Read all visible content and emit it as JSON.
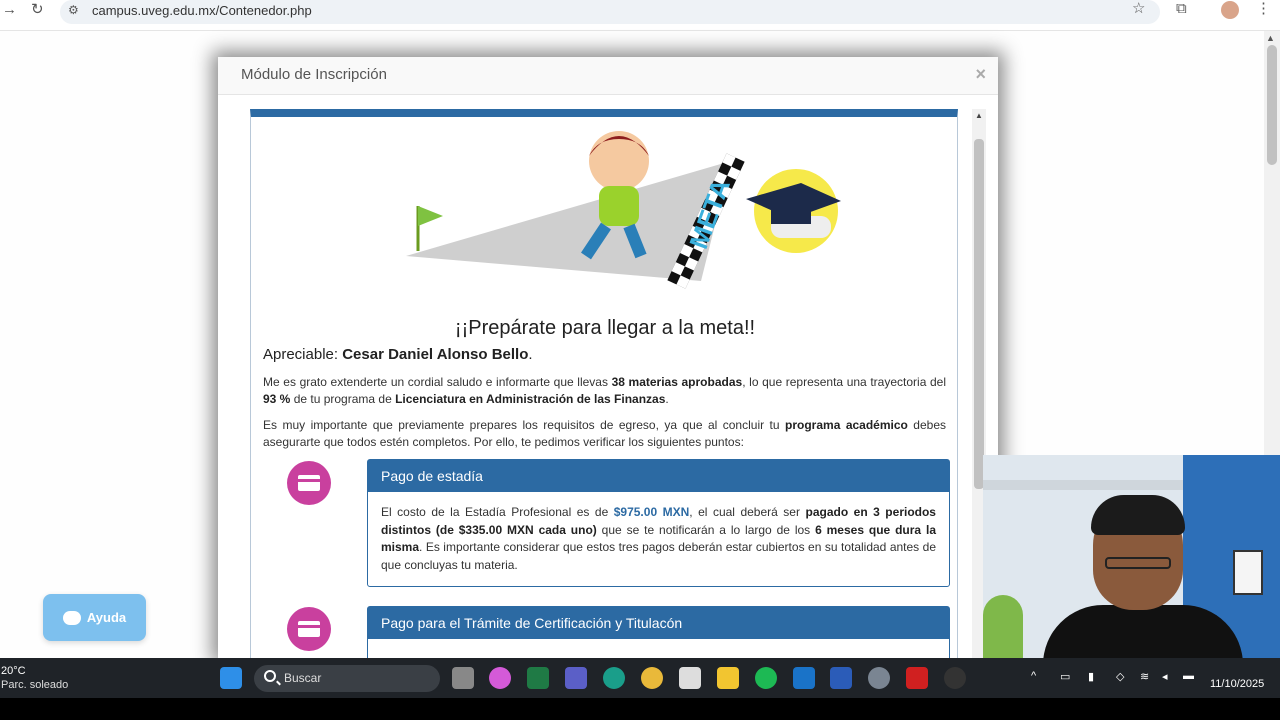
{
  "browser": {
    "url": "campus.uveg.edu.mx/Contenedor.php"
  },
  "modal": {
    "title": "Módulo de Inscripción",
    "close": "×",
    "illustration_text": "META",
    "heading": "¡¡Prepárate para llegar a la meta!!",
    "salutation_prefix": "Apreciable: ",
    "student_name": "Cesar Daniel Alonso Bello",
    "salutation_suffix": ".",
    "paragraph1": {
      "t1": "Me es grato extenderte un cordial saludo e informarte que llevas ",
      "b1": "38 materias aprobadas",
      "t2": ", lo que representa una trayectoria del ",
      "b2": "93 %",
      "t3": " de tu programa de ",
      "b3": "Licenciatura en Administración de las Finanzas",
      "t4": "."
    },
    "paragraph2": {
      "t1": "Es muy importante que previamente prepares los requisitos de egreso, ya que al concluir tu ",
      "b1": "programa académico",
      "t2": " debes asegurarte que todos estén completos. Por ello, te pedimos verificar los siguientes puntos:"
    },
    "cards": [
      {
        "title": "Pago de estadía",
        "t1": "El costo de la Estadía Profesional es de ",
        "price": "$975.00 MXN",
        "t2": ", el cual deberá ser ",
        "b1": "pagado en 3 periodos distintos (de $335.00 MXN cada uno)",
        "t3": " que se te notificarán a lo largo de los ",
        "b2": "6 meses que dura la misma",
        "t4": ". Es importante considerar que estos tres pagos deberán estar cubiertos en su totalidad antes de que concluyas tu materia."
      },
      {
        "title": "Pago para el Trámite de Certificación y Titulacón"
      }
    ]
  },
  "help_button": {
    "label": "Ayuda"
  },
  "taskbar": {
    "weather_temp": "20°C",
    "weather_desc": "Parc. soleado",
    "search_placeholder": "Buscar",
    "date": "11/10/2025"
  },
  "colors": {
    "accent_blue": "#2c6aa3",
    "magenta": "#c9409e",
    "help_blue": "#7dc0ee"
  }
}
